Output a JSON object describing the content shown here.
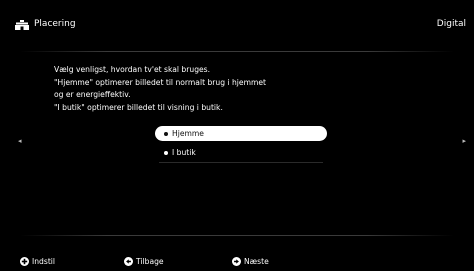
{
  "header": {
    "icon": "shop-icon",
    "title": "Placering",
    "source": "Digital"
  },
  "description": {
    "lines": [
      "Vælg venligst, hvordan tv'et skal bruges.",
      "\"Hjemme\" optimerer billedet til normalt brug i hjemmet",
      "og er energieffektiv.",
      "\"I butik\" optimerer billedet til visning i butik."
    ]
  },
  "options": {
    "items": [
      {
        "label": "Hjemme",
        "selected": true
      },
      {
        "label": "I butik",
        "selected": false
      }
    ]
  },
  "navigation": {
    "left_arrow": "◂",
    "right_arrow": "▸"
  },
  "footer": {
    "indstil": "Indstil",
    "tilbage": "Tilbage",
    "naeste": "Næste"
  },
  "colors": {
    "background": "#000000",
    "selected_bg": "#ffffff",
    "divider": "#3a3a3a"
  }
}
